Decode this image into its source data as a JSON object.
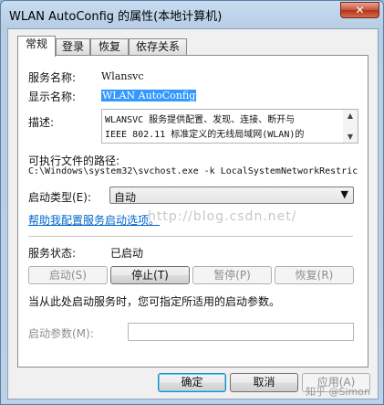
{
  "window": {
    "title": "WLAN AutoConfig 的属性(本地计算机)",
    "close_glyph": "✕"
  },
  "tabs": [
    {
      "label": "常规",
      "active": true
    },
    {
      "label": "登录",
      "active": false
    },
    {
      "label": "恢复",
      "active": false
    },
    {
      "label": "依存关系",
      "active": false
    }
  ],
  "general": {
    "service_name_label": "服务名称:",
    "service_name_value": "Wlansvc",
    "display_name_label": "显示名称:",
    "display_name_value": "WLAN AutoConfig",
    "description_label": "描述:",
    "description_line1": "WLANSVC 服务提供配置、发现、连接、断开与",
    "description_line2": "IEEE 802.11 标准定义的无线局域网(WLAN)的",
    "exe_path_label": "可执行文件的路径:",
    "exe_path_value": "C:\\Windows\\system32\\svchost.exe -k LocalSystemNetworkRestric",
    "startup_type_label": "启动类型(E):",
    "startup_type_value": "自动",
    "help_link": "帮助我配置服务启动选项。",
    "watermark": "http://blog.csdn.net/",
    "status_label": "服务状态:",
    "status_value": "已启动",
    "start_button": "启动(S)",
    "stop_button": "停止(T)",
    "pause_button": "暂停(P)",
    "resume_button": "恢复(R)",
    "hint_text": "当从此处启动服务时，您可指定所适用的启动参数。",
    "start_params_label": "启动参数(M):",
    "start_params_value": ""
  },
  "footer": {
    "ok_button": "确定",
    "cancel_button": "取消",
    "apply_button": "应用(A)",
    "watermark": "知乎 @Simon"
  },
  "icons": {
    "close": "close-icon",
    "dropdown": "chevron-down-icon",
    "scroll_up": "scroll-up-arrow-icon",
    "scroll_down": "scroll-down-arrow-icon"
  }
}
